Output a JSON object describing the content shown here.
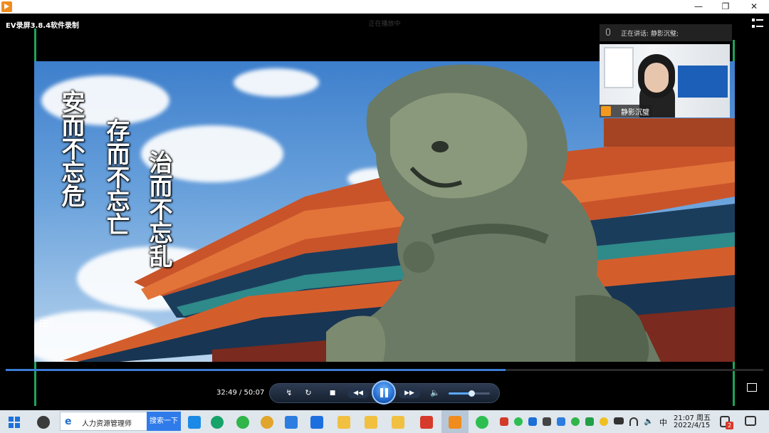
{
  "titlebar": {
    "minimize": "—",
    "restore": "❐",
    "close": "✕"
  },
  "player": {
    "app_title": "EV录屏3.8.4软件录制",
    "top_center_text": "正在播放中"
  },
  "video": {
    "calligraphy": [
      "安而不忘危",
      "存而不忘亡",
      "治而不忘乱"
    ]
  },
  "presenter": {
    "speaking_text": "正在讲话: 静影沉璧;",
    "name": "静影沉璧"
  },
  "playback": {
    "current_time": "32:49",
    "total_time": "50:07",
    "time_display": "32:49 / 50:07",
    "progress": 0.66,
    "volume": 0.55
  },
  "controls": {
    "prev_icon": "↯",
    "replay_icon": "↻",
    "stop_icon": "■",
    "rewind_icon": "◀◀",
    "forward_icon": "▶▶",
    "volume_icon": "🔈"
  },
  "taskbar": {
    "search_placeholder": "人力资源管理师",
    "search_button": "搜索一下",
    "clock_time": "21:07",
    "clock_weekday": "周五",
    "clock_date": "2022/4/15",
    "ime": "中",
    "notification_badge": "2"
  },
  "colors": {
    "accent": "#3a7bd5",
    "edge_green": "#1fa35a",
    "taskbar_bg": "#dfe6ec"
  }
}
